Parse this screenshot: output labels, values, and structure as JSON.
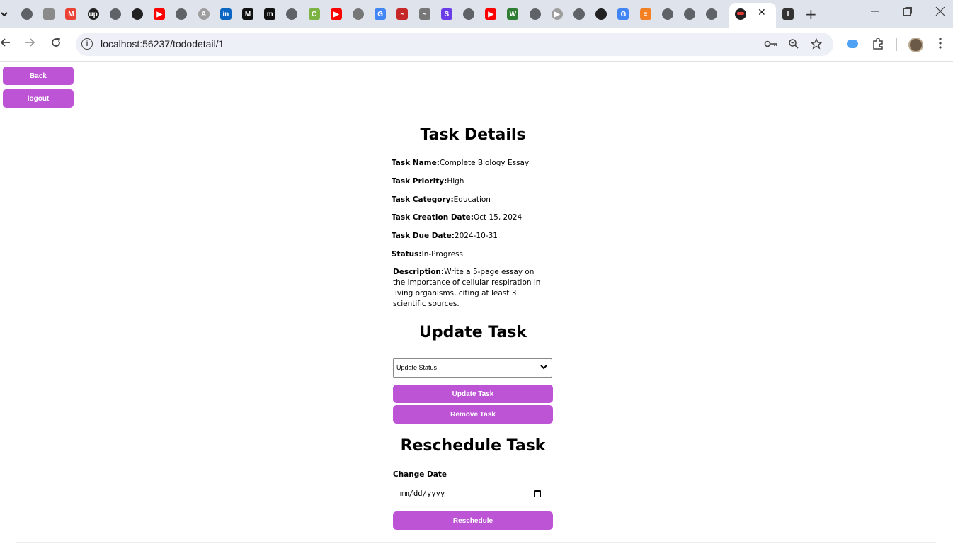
{
  "browser": {
    "url": "localhost:56237/tododetail/1",
    "tab_dropdown_icon": "chevron-down-icon",
    "close_tab_symbol": "✕",
    "new_tab_symbol": "+",
    "favicons": [
      "globe",
      "image",
      "gmail",
      "upwork",
      "globe",
      "github",
      "youtube",
      "globe",
      "angular",
      "linkedin",
      "medium",
      "m-square",
      "globe",
      "c-green",
      "youtube",
      "drop",
      "google",
      "red-swoosh",
      "swoosh",
      "s-purple",
      "globe",
      "youtube",
      "w-green",
      "globe",
      "play",
      "globe",
      "github",
      "google",
      "stackoverflow",
      "globe",
      "globe",
      "globe"
    ]
  },
  "sidebar": {
    "back_label": "Back",
    "logout_label": "logout"
  },
  "details": {
    "title": "Task Details",
    "fields": [
      {
        "label": "Task Name:",
        "value": "Complete Biology Essay"
      },
      {
        "label": "Task Priority:",
        "value": "High"
      },
      {
        "label": "Task Category:",
        "value": "Education"
      },
      {
        "label": "Task Creation Date:",
        "value": "Oct 15, 2024"
      },
      {
        "label": "Task Due Date:",
        "value": "2024-10-31"
      },
      {
        "label": "Status:",
        "value": "In-Progress"
      }
    ],
    "description_label": "Description:",
    "description_value": "Write a 5-page essay on the importance of cellular respiration in living organisms, citing at least 3 scientific sources."
  },
  "update": {
    "title": "Update Task",
    "select_value": "Update Status",
    "update_label": "Update Task",
    "remove_label": "Remove Task"
  },
  "reschedule": {
    "title": "Reschedule Task",
    "change_date_label": "Change Date",
    "date_placeholder": "mm/dd/yyyy",
    "button_label": "Reschedule"
  },
  "colors": {
    "accent": "#bd54d6",
    "tabstrip": "#dfe3eb",
    "omnibox": "#edf0f6"
  }
}
